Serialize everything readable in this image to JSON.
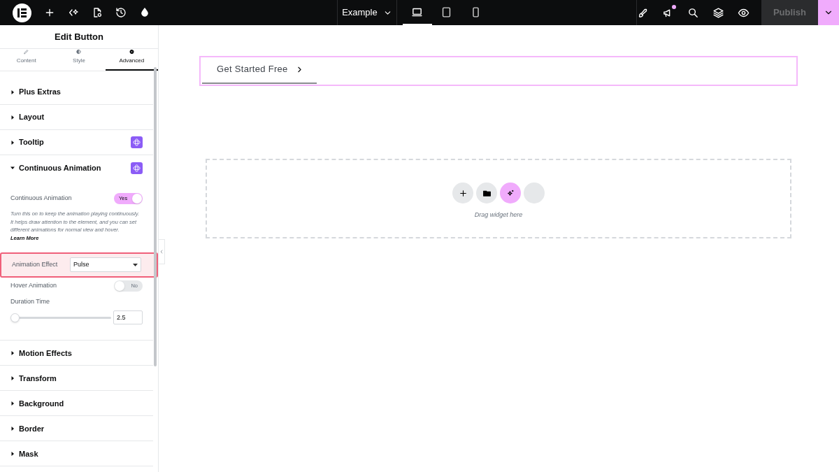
{
  "topbar": {
    "page_selector": "Example",
    "devices": [
      {
        "kind": "desktop",
        "selected": true
      },
      {
        "kind": "tablet",
        "selected": false
      },
      {
        "kind": "mobile",
        "selected": false
      }
    ],
    "notification": true,
    "publish": {
      "label": "Publish",
      "disabled": true
    }
  },
  "panel": {
    "title": "Edit Button",
    "tabs": [
      {
        "label": "Content",
        "kind": "pencil",
        "selected": false
      },
      {
        "label": "Style",
        "kind": "contrast",
        "selected": false
      },
      {
        "label": "Advanced",
        "kind": "gear",
        "selected": true
      }
    ],
    "sections_before": [
      {
        "title": "Plus Extras",
        "expanded": false,
        "pro": false
      },
      {
        "title": "Layout",
        "expanded": false,
        "pro": false
      },
      {
        "title": "Tooltip",
        "expanded": false,
        "pro": true
      },
      {
        "title": "Continuous Animation",
        "expanded": true,
        "pro": true
      }
    ],
    "controls": [
      {
        "kind": "switch",
        "label": "Continuous Animation",
        "on": true,
        "value": "Yes"
      },
      {
        "kind": "description",
        "text": "Turn this on to keep the animation playing continuously. It helps draw attention to the element, and you can set different animations for normal view and hover.",
        "link": "Learn More"
      },
      {
        "kind": "select",
        "label": "Animation Effect",
        "value": "Pulse",
        "highlighted": true
      },
      {
        "kind": "switch",
        "label": "Hover Animation",
        "on": false,
        "value": "No"
      },
      {
        "kind": "slider",
        "label": "Duration Time",
        "level": 0.0,
        "value": "2.5"
      }
    ],
    "sections_after": [
      {
        "title": "Motion Effects",
        "expanded": false,
        "pro": false
      },
      {
        "title": "Transform",
        "expanded": false,
        "pro": false
      },
      {
        "title": "Background",
        "expanded": false,
        "pro": false
      },
      {
        "title": "Border",
        "expanded": false,
        "pro": false
      },
      {
        "title": "Mask",
        "expanded": false,
        "pro": false
      }
    ]
  },
  "canvas": {
    "button_label": "Get Started Free",
    "drop_hint": "Drag widget here"
  }
}
